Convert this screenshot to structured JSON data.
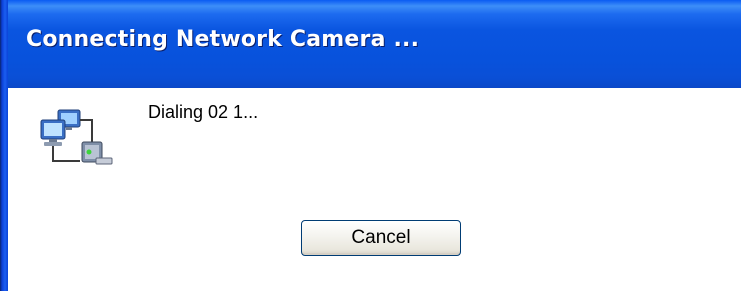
{
  "window": {
    "title": "Connecting Network Camera ..."
  },
  "dialog": {
    "status_text": "Dialing 02 1...",
    "icon": "network-connection-icon"
  },
  "buttons": {
    "cancel_label": "Cancel"
  },
  "colors": {
    "titlebar": "#0a55e0",
    "client_background": "#ffffff",
    "button_border": "#003c74"
  }
}
